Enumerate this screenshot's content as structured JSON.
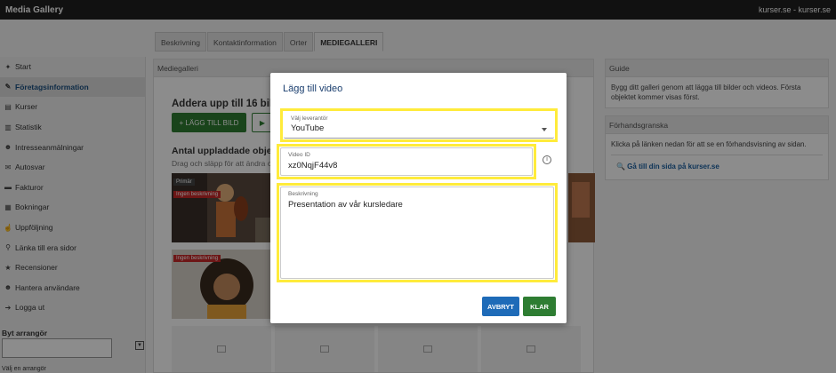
{
  "app": {
    "title": "Media Gallery",
    "site": "kurser.se - kurser.se"
  },
  "tabs": [
    {
      "label": "Beskrivning"
    },
    {
      "label": "Kontaktinformation"
    },
    {
      "label": "Orter"
    },
    {
      "label": "MEDIEGALLERI"
    }
  ],
  "sidebar": {
    "items": [
      {
        "label": "Start",
        "icon": "home-icon",
        "glyph": "✦"
      },
      {
        "label": "Företagsinformation",
        "icon": "edit-icon",
        "glyph": "✎"
      },
      {
        "label": "Kurser",
        "icon": "table-icon",
        "glyph": "▤"
      },
      {
        "label": "Statistik",
        "icon": "chart-icon",
        "glyph": "▥"
      },
      {
        "label": "Intresseanmälningar",
        "icon": "users-icon",
        "glyph": "☻"
      },
      {
        "label": "Autosvar",
        "icon": "envelope-icon",
        "glyph": "✉"
      },
      {
        "label": "Fakturor",
        "icon": "invoice-icon",
        "glyph": "▬"
      },
      {
        "label": "Bokningar",
        "icon": "calendar-icon",
        "glyph": "▦"
      },
      {
        "label": "Uppföljning",
        "icon": "thumbs-up-icon",
        "glyph": "☝"
      },
      {
        "label": "Länka till era sidor",
        "icon": "link-icon",
        "glyph": "⚲"
      },
      {
        "label": "Recensioner",
        "icon": "star-icon",
        "glyph": "★"
      },
      {
        "label": "Hantera användare",
        "icon": "users-icon",
        "glyph": "☻"
      },
      {
        "label": "Logga ut",
        "icon": "logout-icon",
        "glyph": "➔"
      }
    ],
    "arranger_label": "Byt arrangör",
    "arranger_hint": "Välj en arrangör"
  },
  "main": {
    "header": "Mediegalleri",
    "heading": "Addera upp till 16 bilder e",
    "add_image_label": "+ LÄGG TILL BILD",
    "add_video_glyph": "▶",
    "count_heading": "Antal uppladdade objekt -",
    "drag_hint": "Drag och släpp för att ändra or",
    "badge_primary": "Primär",
    "badge_none": "Ingen beskrivning"
  },
  "guide": {
    "header": "Guide",
    "text": "Bygg ditt galleri genom att lägga till bilder och videos. Första objektet kommer visas först."
  },
  "preview": {
    "header": "Förhandsgranska",
    "text": "Klicka på länken nedan för att se en förhandsvisning av sidan.",
    "link": "🔍 Gå till din sida på kurser.se"
  },
  "modal": {
    "title": "Lägg till video",
    "provider_label": "Välj leverantör",
    "provider_value": "YouTube",
    "video_id_label": "Video ID",
    "video_id_value": "xz0NqjF44v8",
    "description_label": "Beskrivning",
    "description_value": "Presentation av vår kursledare",
    "cancel_label": "AVBRYT",
    "done_label": "KLAR"
  },
  "colors": {
    "highlight": "#ffeb3b",
    "primary_blue": "#1e6bb8",
    "success_green": "#2e7d32"
  }
}
